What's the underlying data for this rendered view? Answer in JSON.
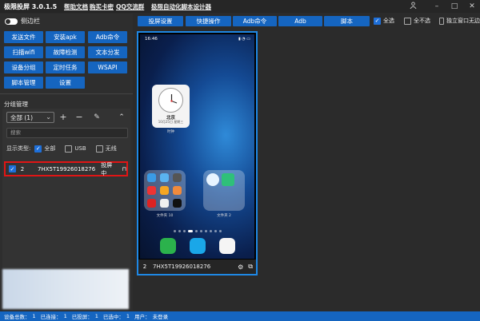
{
  "app": {
    "title": "极限投屏 3.0.1.5",
    "menus": [
      "帮助文档",
      "购买卡密",
      "QQ交流群",
      "极限自动化脚本设计器"
    ]
  },
  "sidebar": {
    "toggle_label": "侧边栏",
    "tools": [
      "发送文件",
      "安装apk",
      "Adb命令",
      "扫描wifi",
      "故障检测",
      "文本分发",
      "设备分组",
      "定时任务",
      "WSAPI",
      "脚本管理",
      "设置"
    ]
  },
  "group": {
    "heading": "分组管理",
    "selected": "全部 (1)",
    "search_placeholder": "搜索",
    "display_type_label": "显示类型:",
    "filters": [
      {
        "label": "全部",
        "checked": true
      },
      {
        "label": "USB",
        "checked": false
      },
      {
        "label": "无线",
        "checked": false
      }
    ],
    "devices": [
      {
        "index": "2",
        "id": "7HX5T19926018276",
        "status": "投屏中",
        "checked": true
      }
    ]
  },
  "toolbar": {
    "buttons": [
      "投屏设置",
      "快捷操作",
      "Adb命令",
      "Adb",
      "脚本"
    ],
    "select_all": "全选",
    "select_none": "全不选",
    "independent": "独立窗口无边"
  },
  "phone": {
    "time": "16:46",
    "clock_city": "北京",
    "clock_date": "10月25日 星期三",
    "clock_label": "时钟",
    "folder1_label": "文件夹 10",
    "folder2_label": "文件夹 2",
    "index": "2",
    "device_id": "7HX5T19926018276"
  },
  "statusbar": {
    "items": [
      "设备总数：",
      "1",
      "已连接：",
      "1",
      "已投屏：",
      "1",
      "已选中：",
      "1",
      "用户：",
      "未登录"
    ]
  },
  "colors": {
    "accent": "#1565c0",
    "highlight": "#e01515",
    "phone_border": "#1e88e5"
  }
}
